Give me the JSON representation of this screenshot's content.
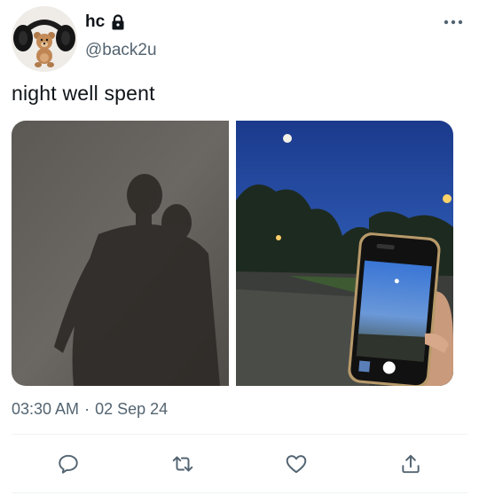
{
  "user": {
    "display_name": "hc",
    "handle": "@back2u",
    "protected_icon": "lock-icon",
    "avatar": "teddy-bear-with-headphones"
  },
  "tweet": {
    "text": "night well spent",
    "time": "03:30 AM",
    "separator": "·",
    "date": "02 Sep 24"
  },
  "media": [
    {
      "name": "shadow-photo",
      "subject": "shadow-of-couple"
    },
    {
      "name": "night-phone-photo",
      "subject": "phone-camera-night-sky"
    }
  ],
  "actions": [
    {
      "name": "reply-button",
      "icon": "speech-bubble-icon"
    },
    {
      "name": "retweet-button",
      "icon": "retweet-icon"
    },
    {
      "name": "like-button",
      "icon": "heart-icon"
    },
    {
      "name": "share-button",
      "icon": "share-icon"
    }
  ],
  "colors": {
    "text_primary": "#0f1419",
    "text_secondary": "#536471",
    "divider": "#eff3f4"
  }
}
